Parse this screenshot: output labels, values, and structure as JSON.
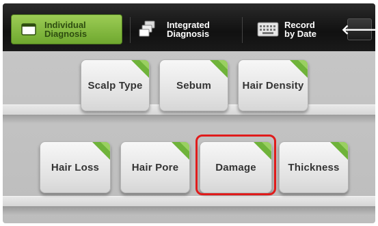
{
  "tabs": [
    {
      "label": "Individual\nDiagnosis",
      "icon": "window-icon",
      "selected": true
    },
    {
      "label": "Integrated\nDiagnosis",
      "icon": "stacked-cards-icon",
      "selected": false
    },
    {
      "label": "Record\nby Date",
      "icon": "keyboard-icon",
      "selected": false
    }
  ],
  "back_button": {
    "icon": "back-arrow-icon",
    "glyph": "🡐"
  },
  "items_row1": [
    "Scalp Type",
    "Sebum",
    "Hair Density"
  ],
  "items_row2": [
    "Hair Loss",
    "Hair Pore",
    "Damage",
    "Thickness"
  ],
  "highlighted_item": "Damage",
  "colors": {
    "accent_green": "#6fb33a",
    "highlight_red": "#e01b1b"
  }
}
